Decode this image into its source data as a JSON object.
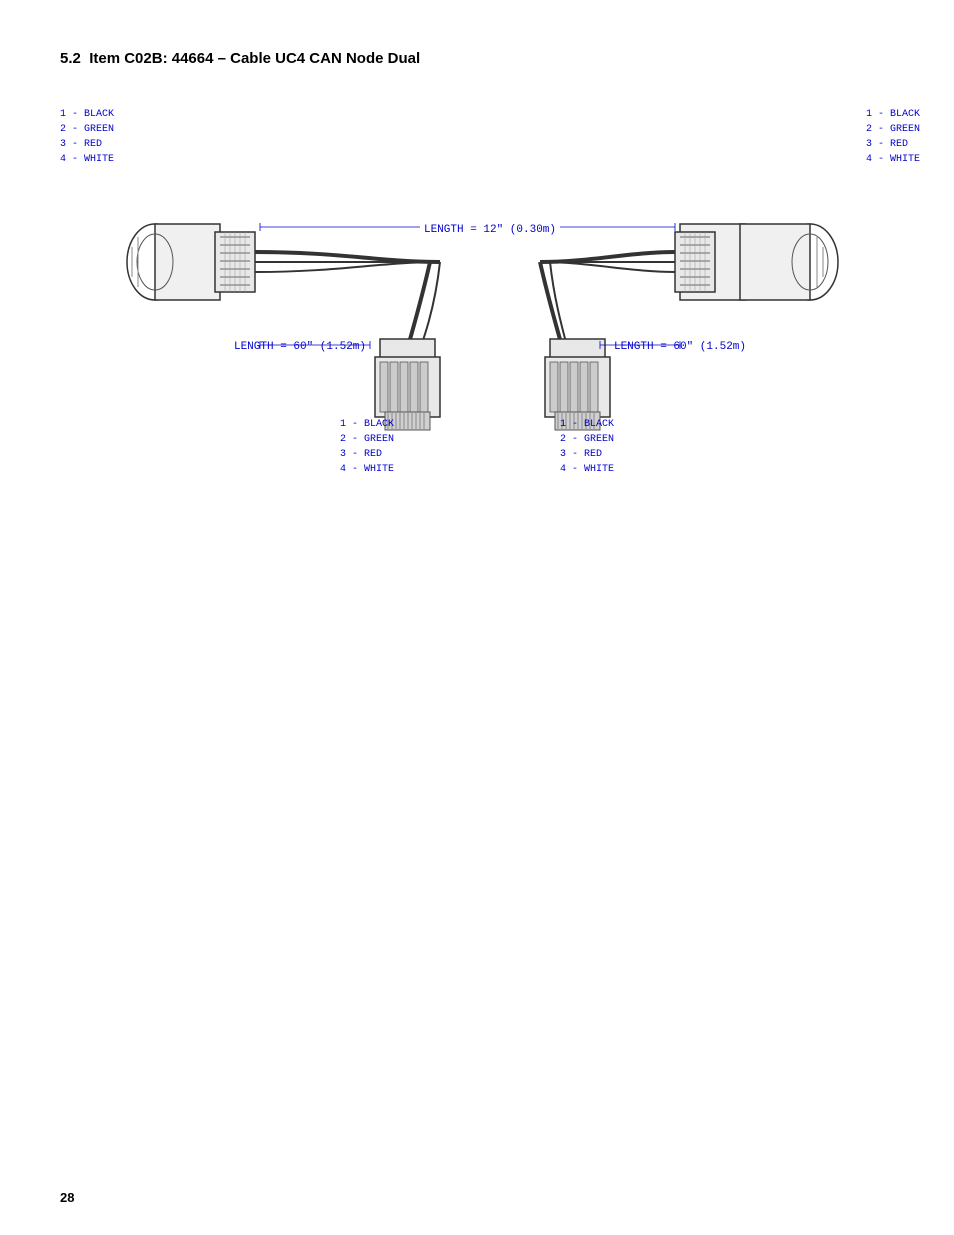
{
  "section": {
    "number": "5.2",
    "title_prefix": "Item C02B: 44664 – Cable UC4 CAN Node Dual"
  },
  "labels": {
    "left_top": [
      "1 - BLACK",
      "2 - GREEN",
      "3 - RED",
      "4 - WHITE"
    ],
    "right_top": [
      "1 - BLACK",
      "2 - GREEN",
      "3 - RED",
      "4 - WHITE"
    ],
    "bottom_left": [
      "1 - BLACK",
      "2 - GREEN",
      "3 - RED",
      "4 - WHITE"
    ],
    "bottom_right": [
      "1 - BLACK",
      "2 - GREEN",
      "3 - RED",
      "4 - WHITE"
    ]
  },
  "lengths": {
    "top": "LENGTH = 12\" (0.30m)",
    "bottom_left": "LENGTH = 60\" (1.52m)",
    "bottom_right": "LENGTH = 60\" (1.52m)"
  },
  "page_number": "28"
}
